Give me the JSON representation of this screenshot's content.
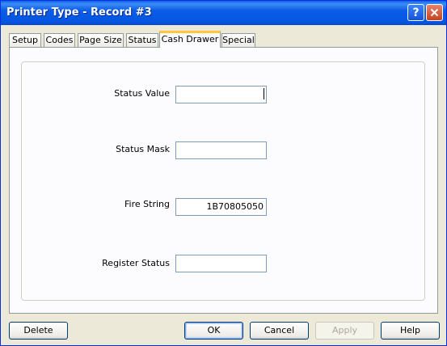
{
  "window": {
    "title": "Printer Type - Record #3"
  },
  "titlebar": {
    "help_label": "?",
    "close_label": "✕"
  },
  "tabs": [
    {
      "label": "Setup",
      "active": false
    },
    {
      "label": "Codes",
      "active": false
    },
    {
      "label": "Page Size",
      "active": false
    },
    {
      "label": "Status",
      "active": false
    },
    {
      "label": "Cash Drawer",
      "active": true
    },
    {
      "label": "Special",
      "active": false
    }
  ],
  "fields": {
    "status_value": {
      "label": "Status Value",
      "value": ""
    },
    "status_mask": {
      "label": "Status Mask",
      "value": ""
    },
    "fire_string": {
      "label": "Fire String",
      "value": "1B70805050"
    },
    "register_status": {
      "label": "Register Status",
      "value": ""
    }
  },
  "buttons": {
    "delete": "Delete",
    "ok": "OK",
    "cancel": "Cancel",
    "apply": "Apply",
    "help": "Help"
  },
  "colors": {
    "title_bar": "#0455e0",
    "active_tab_accent": "#ffc83c",
    "face": "#ece9d8"
  }
}
